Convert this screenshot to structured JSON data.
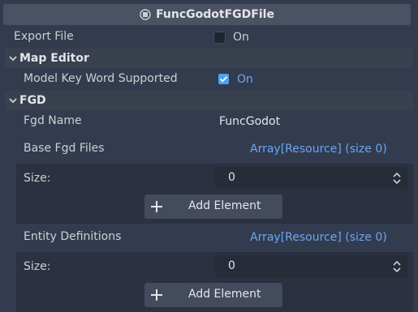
{
  "header": {
    "title": "FuncGodotFGDFile",
    "icon": "resource-icon"
  },
  "export_file": {
    "label": "Export File",
    "value_label": "On",
    "checked": false
  },
  "map_editor": {
    "section_label": "Map Editor",
    "model_key_word_supported": {
      "label": "Model Key Word Supported",
      "value_label": "On",
      "checked": true
    }
  },
  "fgd": {
    "section_label": "FGD",
    "fgd_name": {
      "label": "Fgd Name",
      "value": "FuncGodot"
    },
    "base_fgd_files": {
      "label": "Base Fgd Files",
      "value": "Array[Resource] (size 0)",
      "size_label": "Size:",
      "size_value": "0",
      "add_label": "Add Element"
    },
    "entity_definitions": {
      "label": "Entity Definitions",
      "value": "Array[Resource] (size 0)",
      "size_label": "Size:",
      "size_value": "0",
      "add_label": "Add Element"
    }
  },
  "colors": {
    "accent": "#4fa0f0",
    "link": "#69a8ef",
    "background": "#333b4f"
  }
}
